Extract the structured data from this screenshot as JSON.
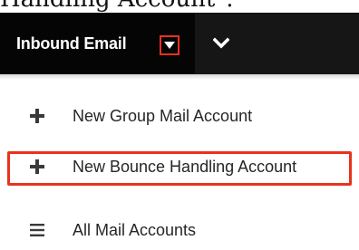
{
  "page_heading": "Handling Account\".",
  "navbar": {
    "tab_label": "Inbound Email",
    "caret_icon": "caret-down-icon",
    "chevron_icon": "chevron-down-icon"
  },
  "menu": {
    "items": [
      {
        "label": "New Group Mail Account",
        "icon": "plus-icon"
      },
      {
        "label": "New Bounce Handling Account",
        "icon": "plus-icon",
        "highlighted": true
      },
      {
        "label": "All Mail Accounts",
        "icon": "list-icon"
      }
    ]
  },
  "colors": {
    "navbar_bg": "#161616",
    "tab_bg": "#050505",
    "highlight": "#e8321c",
    "menu_text": "#262626"
  }
}
